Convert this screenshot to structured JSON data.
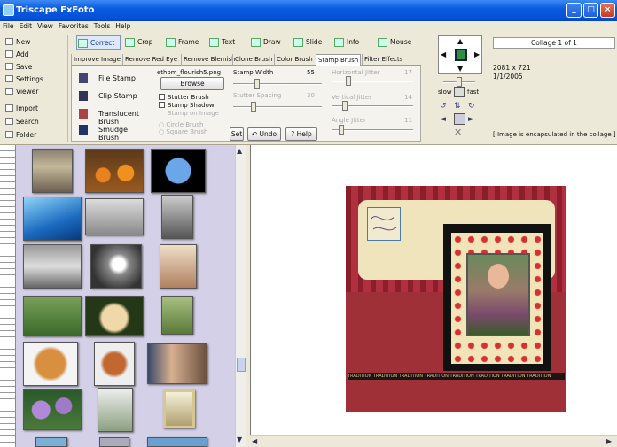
{
  "window": {
    "title": "Triscape FxFoto"
  },
  "menu": [
    "File",
    "Edit",
    "View",
    "Favorites",
    "Tools",
    "Help"
  ],
  "left_nav": [
    "New",
    "Add",
    "Save",
    "Settings",
    "Viewer",
    "Import",
    "Search",
    "Folder"
  ],
  "modes": [
    {
      "label": "Correct",
      "selected": true
    },
    {
      "label": "Crop"
    },
    {
      "label": "Frame"
    },
    {
      "label": "Text"
    },
    {
      "label": "Draw"
    },
    {
      "label": "Slide"
    },
    {
      "label": "Info"
    },
    {
      "label": "Mouse"
    }
  ],
  "subtabs": [
    "Improve Image",
    "Remove Red Eye",
    "Remove Blemish",
    "Clone Brush",
    "Color Brush",
    "Stamp Brush",
    "Filter Effects"
  ],
  "stamp": {
    "tools": [
      "File Stamp",
      "Clip Stamp",
      "Translucent Brush",
      "Smudge Brush"
    ],
    "filename": "ethom_flourish5.png",
    "browse": "Browse",
    "options": [
      "Stutter Brush",
      "Stamp Shadow"
    ],
    "disabled_options": [
      "Stamp on Image",
      "Circle Brush",
      "Square Brush"
    ],
    "stamp_width_label": "Stamp Width",
    "stamp_width_value": "55",
    "stutter_spacing_label": "Stutter Spacing",
    "stutter_spacing_value": "30",
    "horizontal_jitter_label": "Horizontal Jitter",
    "horizontal_jitter_value": "17",
    "vertical_jitter_label": "Vertical Jitter",
    "vertical_jitter_value": "14",
    "angle_jitter_label": "Angle Jitter",
    "angle_jitter_value": "11",
    "set": "Set",
    "undo": "Undo",
    "help": "Help"
  },
  "nav": {
    "slow": "slow",
    "fast": "fast"
  },
  "info": {
    "collage": "Collage 1 of 1",
    "size": "2081 x 721",
    "date": "1/1/2005",
    "note": "[ Image is encapsulated in the collage ]"
  },
  "collage": {
    "banner": "TRADITION TRADITION TRADITION TRADITION TRADITION TRADITION TRADITION TRADITION"
  },
  "colors": {
    "titlebar": "#0a5be0",
    "thumb_bg": "#d4d0e8",
    "red": "#a8313a"
  }
}
